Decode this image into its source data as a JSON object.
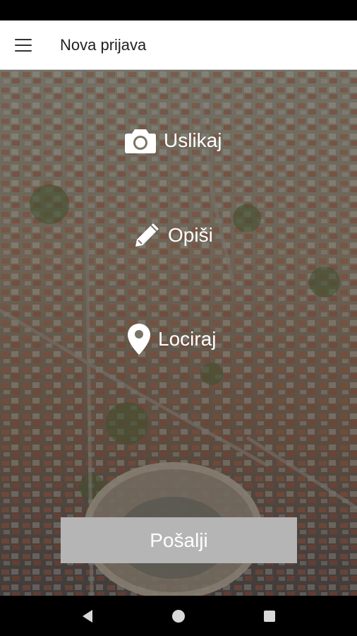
{
  "app_bar": {
    "title": "Nova prijava",
    "menu_icon": "hamburger-menu-icon"
  },
  "actions": {
    "capture": {
      "label": "Uslikaj",
      "icon": "camera-icon"
    },
    "describe": {
      "label": "Opiši",
      "icon": "pencil-icon"
    },
    "locate": {
      "label": "Lociraj",
      "icon": "location-pin-icon"
    }
  },
  "send": {
    "label": "Pošalji"
  },
  "colors": {
    "app_bar_bg": "#ffffff",
    "send_button_bg": "#b5b5b5",
    "action_text": "#ffffff",
    "nav_bar_bg": "#000000"
  },
  "nav": {
    "back_icon": "back-triangle-icon",
    "home_icon": "home-circle-icon",
    "recents_icon": "recents-square-icon"
  }
}
